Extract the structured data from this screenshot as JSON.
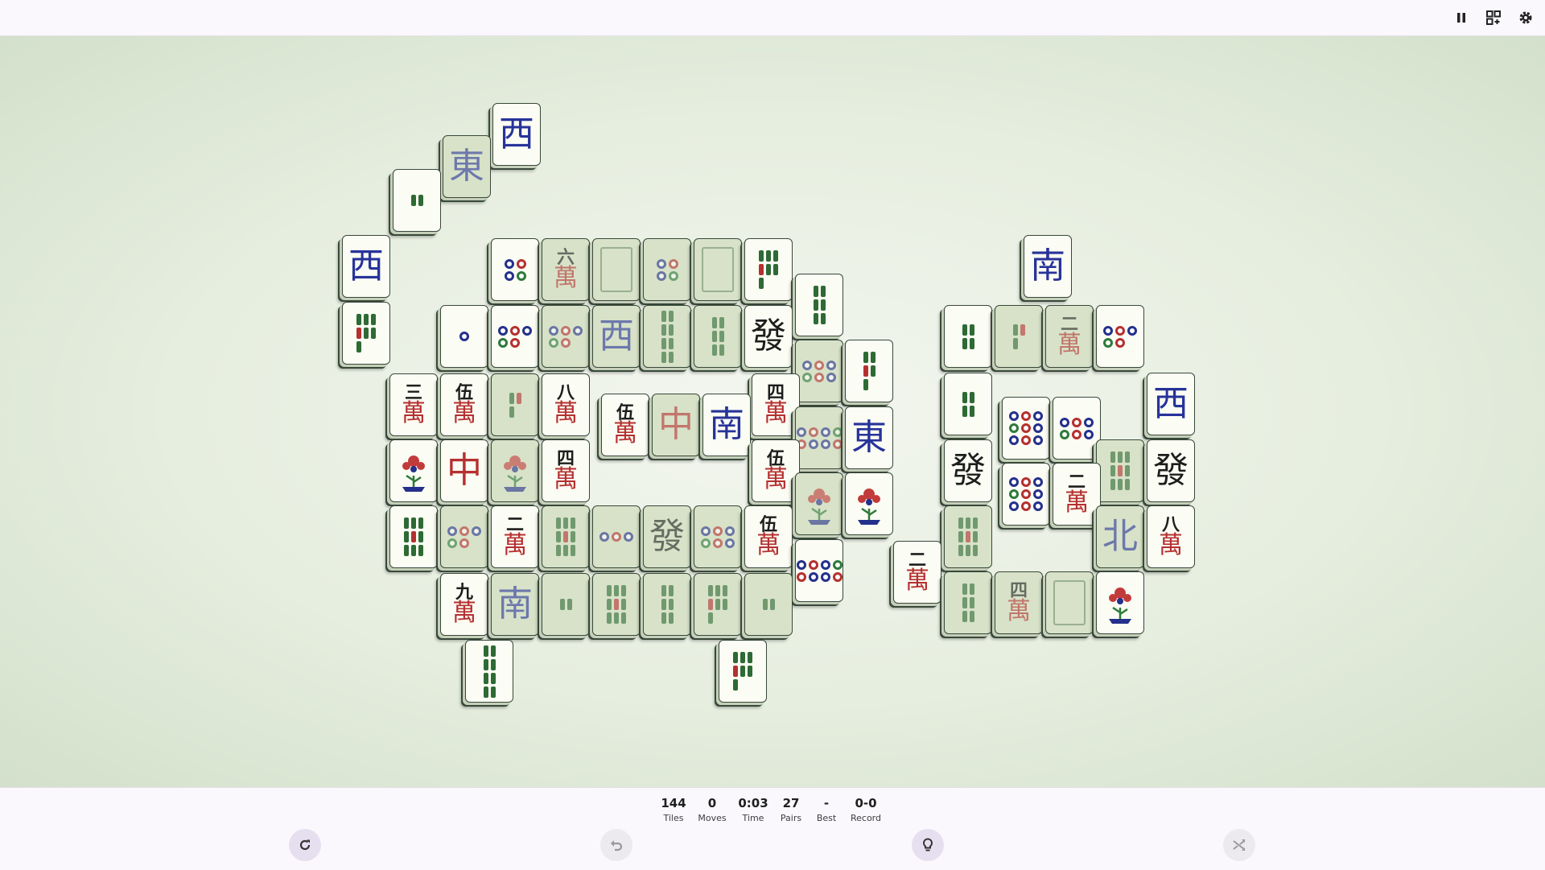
{
  "topbar": {
    "icons": [
      "pause-icon",
      "layout-icon",
      "gear-icon"
    ]
  },
  "status": {
    "tiles": {
      "value": "144",
      "label": "Tiles"
    },
    "moves": {
      "value": "0",
      "label": "Moves"
    },
    "time": {
      "value": "0:03",
      "label": "Time"
    },
    "pairs": {
      "value": "27",
      "label": "Pairs"
    },
    "best": {
      "value": "-",
      "label": "Best"
    },
    "record": {
      "value": "0-0",
      "label": "Record"
    }
  },
  "controls": {
    "icons": [
      "restart-icon",
      "undo-icon",
      "hint-icon",
      "shuffle-icon"
    ]
  },
  "colors": {
    "board_center": "#f3f6ef",
    "board_edge": "#d3e0cb",
    "tile_face": "#fbfcf3",
    "tile_blocked": "#d7e2c8",
    "dragon_blue": "#27339a",
    "dragon_red": "#b53030",
    "bamboo_green": "#2d6a34"
  },
  "tiles": [
    {
      "kind": "wind",
      "glyph": "西",
      "c": "blue",
      "free": true
    },
    {
      "kind": "wind",
      "glyph": "東",
      "c": "blue",
      "free": false
    },
    {
      "kind": "bam",
      "n": 2,
      "free": true
    },
    {
      "kind": "wind",
      "glyph": "西",
      "c": "blue",
      "free": true
    },
    {
      "kind": "bam",
      "n": 7,
      "free": true
    },
    {
      "kind": "circ",
      "n": 4,
      "free": true
    },
    {
      "kind": "char",
      "num": "六",
      "free": false
    },
    {
      "kind": "blank",
      "free": false
    },
    {
      "kind": "circ",
      "n": 4,
      "free": false
    },
    {
      "kind": "blank",
      "free": false
    },
    {
      "kind": "bam",
      "n": 7,
      "free": true
    },
    {
      "kind": "bam",
      "n": 6,
      "free": true
    },
    {
      "kind": "circ",
      "n": 1,
      "free": true
    },
    {
      "kind": "circ",
      "n": 5,
      "free": true
    },
    {
      "kind": "circ",
      "n": 5,
      "free": false
    },
    {
      "kind": "wind",
      "glyph": "西",
      "c": "blue",
      "free": false
    },
    {
      "kind": "bam",
      "n": 8,
      "free": false
    },
    {
      "kind": "bam",
      "n": 6,
      "free": false
    },
    {
      "kind": "dragon",
      "glyph": "發",
      "c": "black",
      "free": true
    },
    {
      "kind": "circ",
      "n": 6,
      "free": false
    },
    {
      "kind": "bam",
      "n": 5,
      "free": true
    },
    {
      "kind": "char",
      "num": "三",
      "free": true
    },
    {
      "kind": "char",
      "num": "伍",
      "free": true
    },
    {
      "kind": "bam",
      "n": 3,
      "free": false
    },
    {
      "kind": "char",
      "num": "八",
      "free": true
    },
    {
      "kind": "char",
      "num": "四",
      "free": true
    },
    {
      "kind": "char",
      "num": "伍",
      "free": true
    },
    {
      "kind": "dragon",
      "glyph": "中",
      "c": "red",
      "free": false
    },
    {
      "kind": "wind",
      "glyph": "南",
      "c": "blue",
      "free": true
    },
    {
      "kind": "circ",
      "n": 8,
      "free": false
    },
    {
      "kind": "wind",
      "glyph": "東",
      "c": "blue",
      "free": true
    },
    {
      "kind": "flower",
      "free": true
    },
    {
      "kind": "dragon",
      "glyph": "中",
      "c": "red",
      "free": true
    },
    {
      "kind": "flower",
      "free": false
    },
    {
      "kind": "char",
      "num": "四",
      "free": true
    },
    {
      "kind": "char",
      "num": "伍",
      "free": true
    },
    {
      "kind": "flower",
      "free": false
    },
    {
      "kind": "flower",
      "free": true
    },
    {
      "kind": "bam",
      "n": 9,
      "free": true
    },
    {
      "kind": "circ",
      "n": 5,
      "free": false
    },
    {
      "kind": "char",
      "num": "二",
      "free": true
    },
    {
      "kind": "bam",
      "n": 9,
      "free": false
    },
    {
      "kind": "circ",
      "n": 3,
      "free": false
    },
    {
      "kind": "dragon",
      "glyph": "發",
      "c": "black",
      "free": false
    },
    {
      "kind": "circ",
      "n": 6,
      "free": false
    },
    {
      "kind": "char",
      "num": "伍",
      "free": true
    },
    {
      "kind": "circ",
      "n": 8,
      "free": true
    },
    {
      "kind": "char",
      "num": "九",
      "free": true
    },
    {
      "kind": "wind",
      "glyph": "南",
      "c": "blue",
      "free": false
    },
    {
      "kind": "bam",
      "n": 2,
      "free": false
    },
    {
      "kind": "bam",
      "n": 9,
      "free": false
    },
    {
      "kind": "bam",
      "n": 6,
      "free": false
    },
    {
      "kind": "bam",
      "n": 7,
      "free": false
    },
    {
      "kind": "bam",
      "n": 2,
      "free": false
    },
    {
      "kind": "bam",
      "n": 8,
      "free": true
    },
    {
      "kind": "bam",
      "n": 7,
      "free": true
    },
    {
      "kind": "char",
      "num": "二",
      "free": true
    },
    {
      "kind": "wind",
      "glyph": "南",
      "c": "blue",
      "free": true
    },
    {
      "kind": "bam",
      "n": 4,
      "free": true
    },
    {
      "kind": "bam",
      "n": 3,
      "free": false
    },
    {
      "kind": "char",
      "num": "二",
      "free": false
    },
    {
      "kind": "circ",
      "n": 5,
      "free": true
    },
    {
      "kind": "bam",
      "n": 4,
      "free": true
    },
    {
      "kind": "circ",
      "n": 9,
      "free": true
    },
    {
      "kind": "circ",
      "n": 6,
      "free": true
    },
    {
      "kind": "wind",
      "glyph": "西",
      "c": "blue",
      "free": true
    },
    {
      "kind": "dragon",
      "glyph": "發",
      "c": "black",
      "free": true
    },
    {
      "kind": "circ",
      "n": 9,
      "free": true
    },
    {
      "kind": "char",
      "num": "二",
      "free": true
    },
    {
      "kind": "bam",
      "n": 9,
      "free": false
    },
    {
      "kind": "dragon",
      "glyph": "發",
      "c": "black",
      "free": true
    },
    {
      "kind": "bam",
      "n": 9,
      "free": false
    },
    {
      "kind": "wind",
      "glyph": "北",
      "c": "blue",
      "free": false
    },
    {
      "kind": "char",
      "num": "八",
      "free": true
    },
    {
      "kind": "bam",
      "n": 6,
      "free": false
    },
    {
      "kind": "char",
      "num": "四",
      "free": false
    },
    {
      "kind": "blank",
      "free": false
    },
    {
      "kind": "flower",
      "free": true
    }
  ]
}
